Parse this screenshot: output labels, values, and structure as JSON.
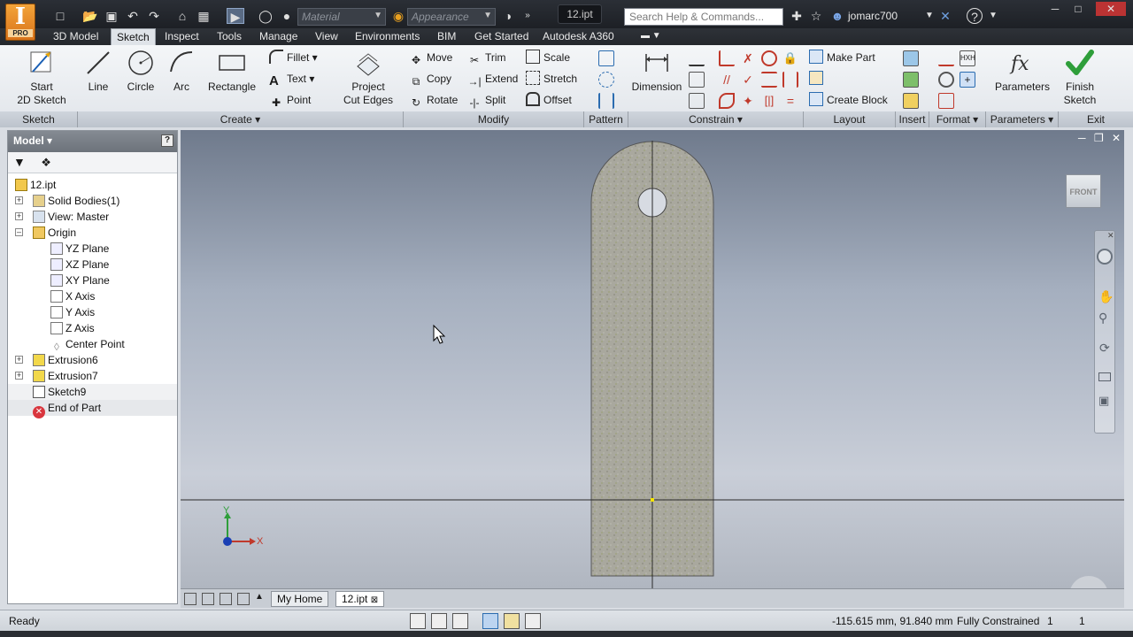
{
  "app": {
    "logo_letter": "I",
    "logo_edition": "PRO",
    "document_title": "12.ipt"
  },
  "titlebar": {
    "material_placeholder": "Material",
    "appearance_placeholder": "Appearance",
    "search_placeholder": "Search Help & Commands...",
    "username": "jomarc700"
  },
  "tabs": [
    "3D Model",
    "Sketch",
    "Inspect",
    "Tools",
    "Manage",
    "View",
    "Environments",
    "BIM",
    "Get Started",
    "Autodesk A360"
  ],
  "active_tab": "Sketch",
  "ribbon": {
    "sketch_panel": {
      "start_label_1": "Start",
      "start_label_2": "2D Sketch",
      "footer": "Sketch"
    },
    "create_panel": {
      "line": "Line",
      "circle": "Circle",
      "arc": "Arc",
      "rectangle": "Rectangle",
      "fillet": "Fillet",
      "text": "Text",
      "point": "Point",
      "project_1": "Project",
      "project_2": "Cut Edges",
      "footer": "Create"
    },
    "modify_panel": {
      "move": "Move",
      "copy": "Copy",
      "rotate": "Rotate",
      "trim": "Trim",
      "extend": "Extend",
      "split": "Split",
      "scale": "Scale",
      "stretch": "Stretch",
      "offset": "Offset",
      "footer": "Modify"
    },
    "pattern_panel": {
      "footer": "Pattern"
    },
    "constrain_panel": {
      "dimension": "Dimension",
      "footer": "Constrain"
    },
    "layout_panel": {
      "make_part": "Make Part",
      "create_block": "Create Block",
      "footer": "Layout"
    },
    "insert_panel": {
      "footer": "Insert"
    },
    "format_panel": {
      "footer": "Format"
    },
    "parameters_panel": {
      "parameters": "Parameters",
      "footer": "Parameters"
    },
    "exit_panel": {
      "finish_1": "Finish",
      "finish_2": "Sketch",
      "footer": "Exit"
    }
  },
  "browser": {
    "title": "Model",
    "help": "?",
    "tree": [
      {
        "label": "12.ipt",
        "icon": "part-icon"
      },
      {
        "label": "Solid Bodies(1)",
        "icon": "solid-bodies-icon"
      },
      {
        "label": "View: Master",
        "icon": "view-icon"
      },
      {
        "label": "Origin",
        "icon": "folder-icon"
      },
      {
        "label": "YZ Plane",
        "icon": "plane-icon"
      },
      {
        "label": "XZ Plane",
        "icon": "plane-icon"
      },
      {
        "label": "XY Plane",
        "icon": "plane-icon"
      },
      {
        "label": "X Axis",
        "icon": "axis-icon"
      },
      {
        "label": "Y Axis",
        "icon": "axis-icon"
      },
      {
        "label": "Z Axis",
        "icon": "axis-icon"
      },
      {
        "label": "Center Point",
        "icon": "center-point-icon"
      },
      {
        "label": "Extrusion6",
        "icon": "extrusion-icon"
      },
      {
        "label": "Extrusion7",
        "icon": "extrusion-icon"
      },
      {
        "label": "Sketch9",
        "icon": "sketch-icon"
      },
      {
        "label": "End of Part",
        "icon": "end-of-part-icon"
      }
    ]
  },
  "viewport": {
    "viewcube_label": "FRONT",
    "axis_x": "X",
    "axis_y": "Y"
  },
  "doctabs": [
    "My Home",
    "12.ipt"
  ],
  "status": {
    "left": "Ready",
    "coords": "-115.615 mm, 91.840 mm",
    "constraint": "Fully Constrained",
    "num1": "1",
    "num2": "1"
  }
}
